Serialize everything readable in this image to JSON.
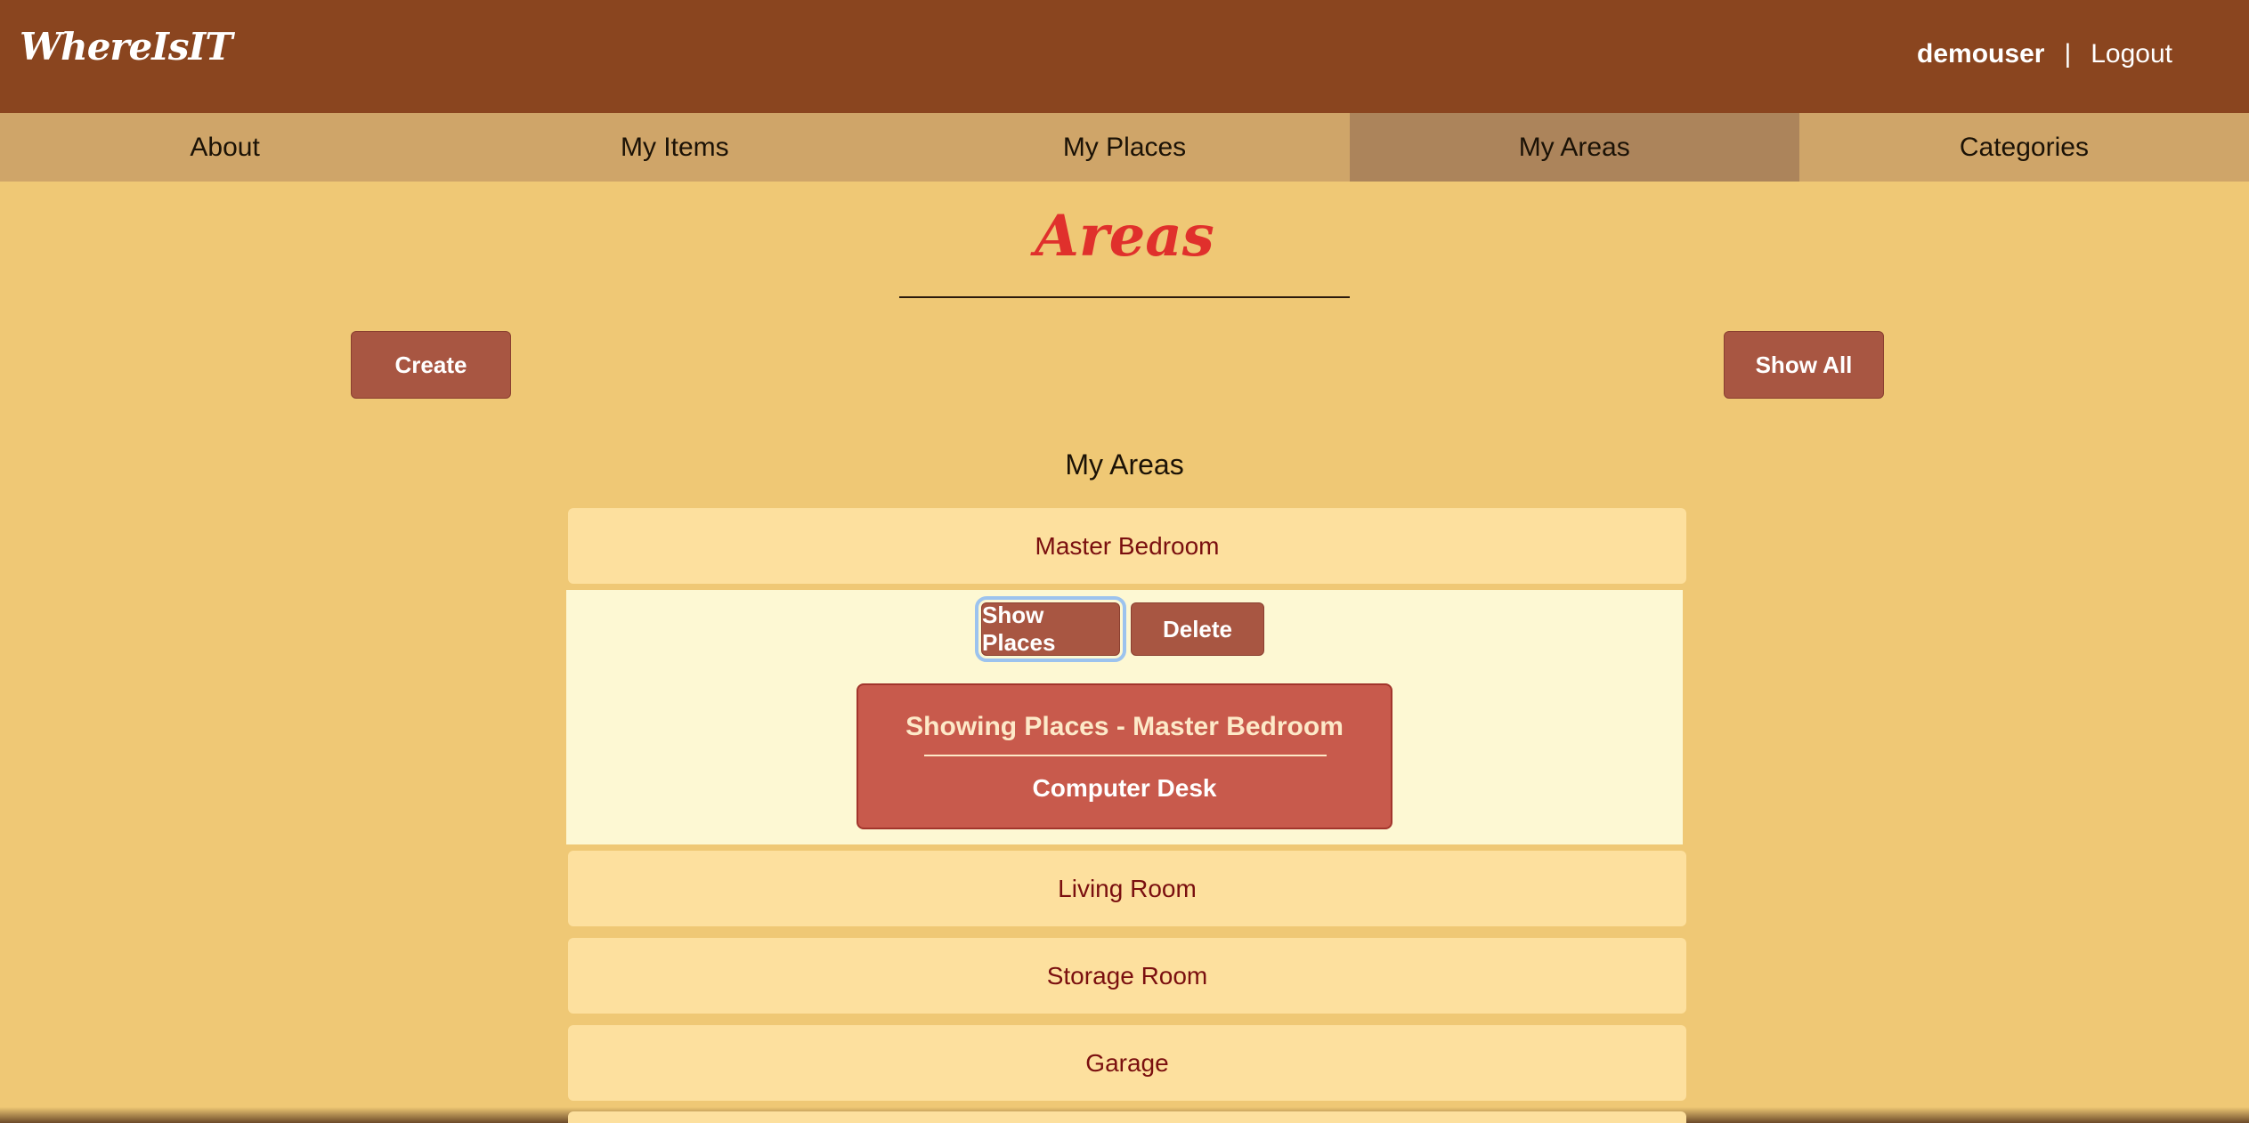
{
  "header": {
    "brand": "WhereIsIT",
    "username": "demouser",
    "separator": "|",
    "logout_label": "Logout",
    "color": "#8a451f"
  },
  "nav": {
    "tabs": [
      {
        "label": "About",
        "active": false
      },
      {
        "label": "My Items",
        "active": false
      },
      {
        "label": "My Places",
        "active": false
      },
      {
        "label": "My Areas",
        "active": true
      },
      {
        "label": "Categories",
        "active": false
      }
    ]
  },
  "page": {
    "title": "Areas",
    "create_label": "Create",
    "show_all_label": "Show All",
    "section_heading": "My Areas"
  },
  "areas": [
    {
      "name": "Master Bedroom",
      "expanded": true
    },
    {
      "name": "Living Room",
      "expanded": false
    },
    {
      "name": "Storage Room",
      "expanded": false
    },
    {
      "name": "Garage",
      "expanded": false
    }
  ],
  "expanded_area": {
    "show_places_label": "Show Places",
    "delete_label": "Delete",
    "places_title": "Showing Places - Master Bedroom",
    "places": [
      "Computer Desk"
    ]
  },
  "colors": {
    "background": "#efc875",
    "nav": "#cfa569",
    "nav_active": "#ac845b",
    "button": "#a85642",
    "title": "#e0302c",
    "row": "#fde09e",
    "row_text": "#7a0f0f",
    "panel": "#c85a4c"
  }
}
